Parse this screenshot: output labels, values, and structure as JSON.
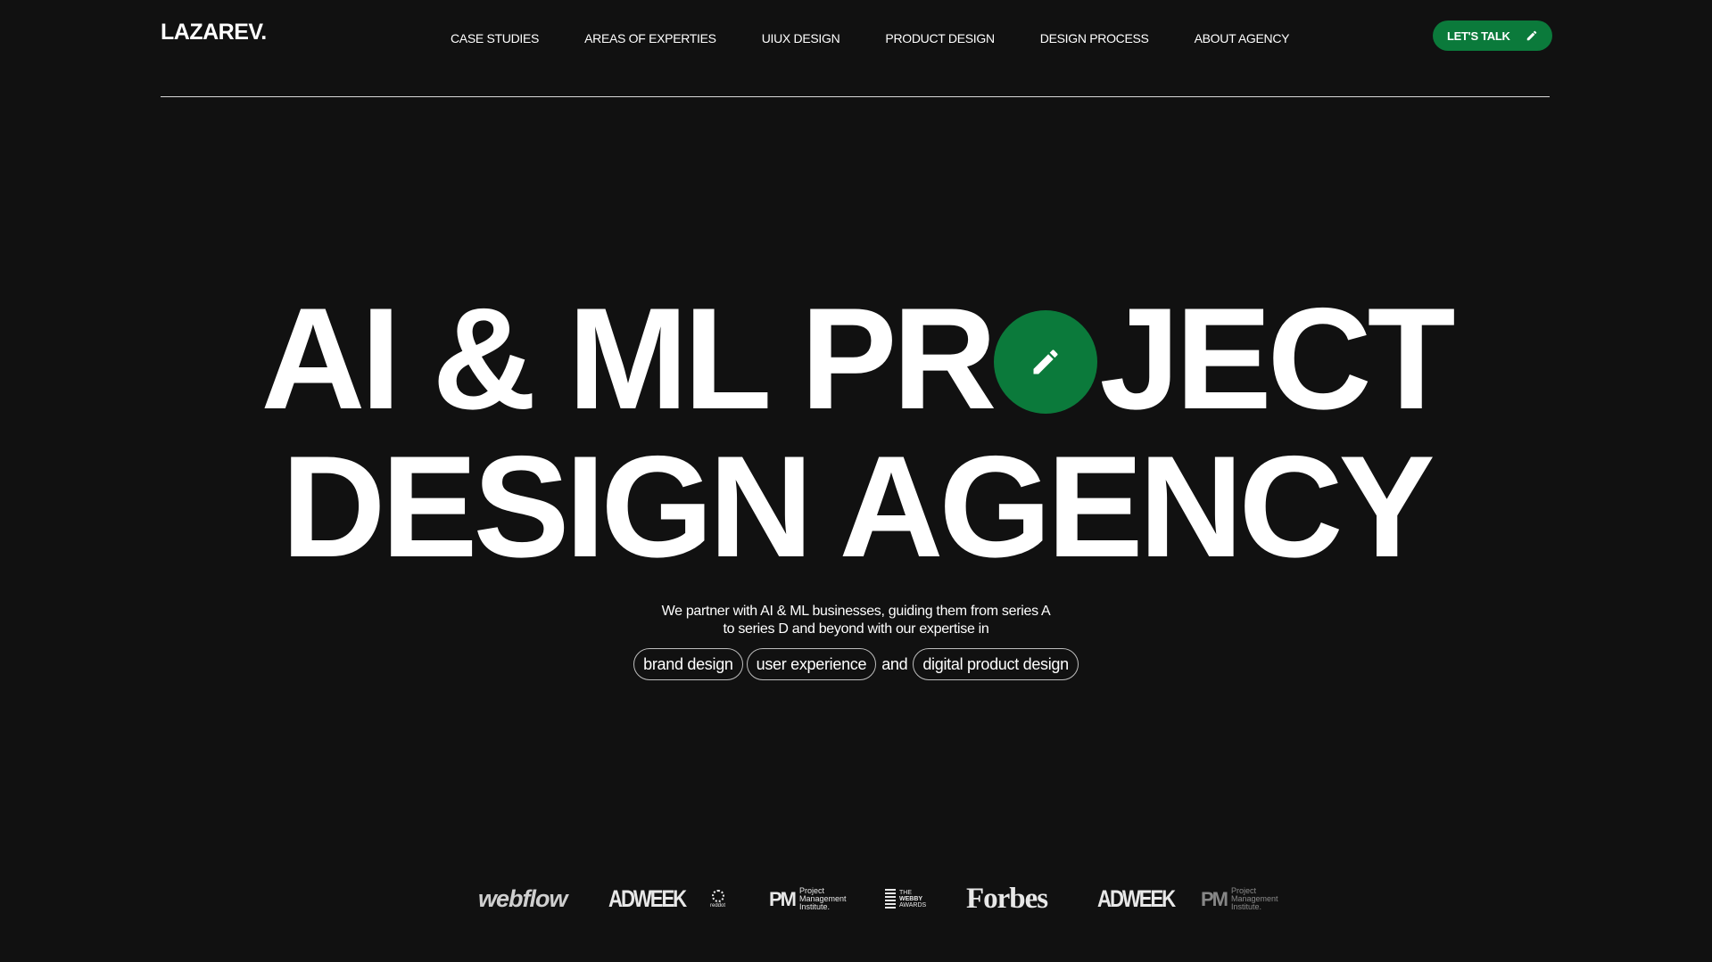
{
  "header": {
    "logo": "LAZAREV.",
    "nav": [
      "CASE STUDIES",
      "AREAS OF EXPERTIES",
      "UIUX DESIGN",
      "PRODUCT DESIGN",
      "DESIGN PROCESS",
      "ABOUT AGENCY"
    ],
    "cta_label": "LET'S TALK"
  },
  "hero": {
    "line1_part1": "AI & ML PR",
    "line1_part2": "JECT",
    "line2": "DESIGN AGENCY",
    "subtitle_line1": "We partner with AI & ML businesses, guiding them from series A",
    "subtitle_line2": "to series D and beyond with our expertise in",
    "pills": [
      "brand design",
      "user experience",
      "digital product design"
    ],
    "pill_connector": "and"
  },
  "logos": {
    "webflow": "webflow",
    "adweek": "ADWEEK",
    "reddot": "reddot",
    "pmi_mark": "PM",
    "pmi_text_1": "Project",
    "pmi_text_2": "Management",
    "pmi_text_3": "Institute.",
    "webby_1": "THE",
    "webby_2": "WEBBY",
    "webby_3": "AWARDS",
    "forbes": "Forbes"
  },
  "colors": {
    "background": "#111111",
    "accent_green": "#0b7a3b",
    "text": "#ffffff"
  },
  "icons": {
    "cta": "pencil-icon",
    "hero_o": "pencil-icon"
  }
}
